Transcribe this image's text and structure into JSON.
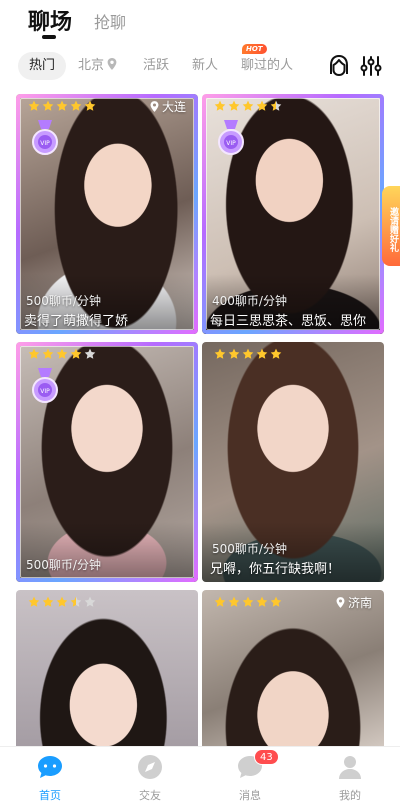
{
  "top_tabs": {
    "main": "聊场",
    "second": "抢聊"
  },
  "filters": {
    "hot": "热门",
    "city": "北京",
    "active": "活跃",
    "new": "新人",
    "chatted": "聊过的人",
    "hot_badge": "HOT"
  },
  "cards": [
    {
      "location": "大连",
      "rating": 5,
      "vip": true,
      "price": "500聊币/分钟",
      "tagline": "卖得了萌撒得了娇"
    },
    {
      "location": "",
      "rating": 4.5,
      "vip": true,
      "price": "400聊币/分钟",
      "tagline": "每日三思思茶、思饭、思你"
    },
    {
      "location": "",
      "rating": 4,
      "vip": true,
      "price": "500聊币/分钟",
      "tagline": ""
    },
    {
      "location": "",
      "rating": 5,
      "vip": false,
      "price": "500聊币/分钟",
      "tagline": "兄嘚，你五行缺我啊！"
    },
    {
      "location": "",
      "rating": 3.5,
      "vip": false,
      "price": "",
      "tagline": ""
    },
    {
      "location": "济南",
      "rating": 5,
      "vip": false,
      "price": "",
      "tagline": ""
    }
  ],
  "invite": {
    "label": "邀请赠好礼"
  },
  "nav": {
    "home": "首页",
    "social": "交友",
    "messages": "消息",
    "messages_badge": "43",
    "mine": "我的"
  },
  "colors": {
    "accent": "#1a9dff",
    "star": "#ffc72c",
    "badge": "#ff4d4f"
  }
}
